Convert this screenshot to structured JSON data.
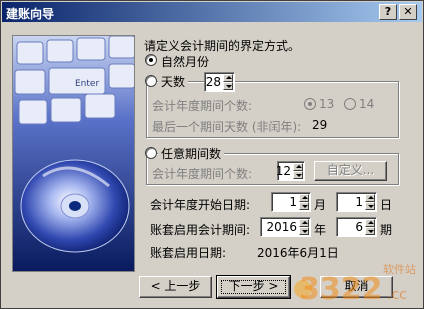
{
  "window": {
    "title": "建账向导"
  },
  "prompt": "请定义会计期间的界定方式。",
  "mode": {
    "natural_month": "自然月份",
    "days": "天数",
    "days_value": "28",
    "period_count_label": "会计年度期间个数:",
    "period_count_opt1": "13",
    "period_count_opt2": "14",
    "last_period_days_label": "最后一个期间天数 (非闰年):",
    "last_period_days_value": "29",
    "arbitrary": "任意期间数",
    "arbitrary_count_label": "会计年度期间个数:",
    "arbitrary_count_value": "12",
    "custom_button": "自定义..."
  },
  "fiscal_start": {
    "label": "会计年度开始日期:",
    "month": "1",
    "month_unit": "月",
    "day": "1",
    "day_unit": "日"
  },
  "enable_period": {
    "label": "账套启用会计期间:",
    "year": "2016",
    "year_unit": "年",
    "period": "6",
    "period_unit": "期"
  },
  "enable_date": {
    "label": "账套启用日期:",
    "value": "2016年6月1日"
  },
  "buttons": {
    "prev": "< 上一步",
    "next": "下一步 >",
    "cancel": "取消"
  },
  "watermark": {
    "brand": "3322",
    "site": "软件站",
    "tld": ".cc"
  },
  "colors": {
    "face": "#d4d0c8",
    "title_start": "#0a246a",
    "title_end": "#a6caf0",
    "art_bg": "#0c2a7c"
  }
}
